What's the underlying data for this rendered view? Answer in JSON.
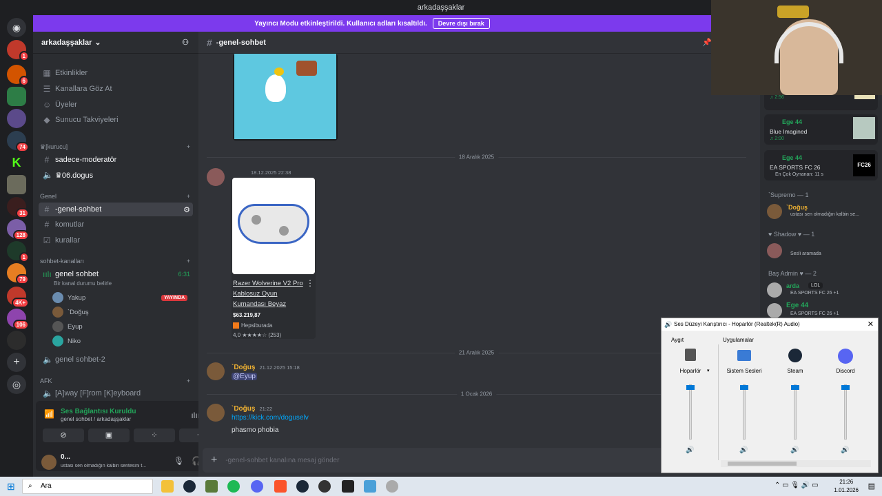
{
  "window": {
    "title": "arkadaşşaklar"
  },
  "banner": {
    "text": "Yayıncı Modu etkinleştirildi. Kullanıcı adları kısaltıldı.",
    "button": "Devre dışı bırak"
  },
  "rail": {
    "badges": [
      "1",
      "6",
      "74",
      "31",
      "128",
      "1",
      "79",
      "4K+",
      "106"
    ]
  },
  "server": {
    "name": "arkadaşşaklar",
    "top_items": [
      "Etkinlikler",
      "Kanallara Göz At",
      "Üyeler",
      "Sunucu Takviyeleri"
    ],
    "categories": {
      "kurucu": "♛[kurucu]",
      "genel": "Genel",
      "sohbet": "sohbet-kanalları",
      "afk": "AFK"
    },
    "channels": {
      "mod": "sadece-moderatör",
      "dogus": "♛06.dogus",
      "genel_sohbet": "-genel-sohbet",
      "komutlar": "komutlar",
      "kurallar": "kurallar",
      "voice_genel": "genel sohbet",
      "voice_status": "Bir kanal durumu belirle",
      "voice_timer": "6:31",
      "voice_genel2": "genel sohbet-2",
      "afk": "[A]way [F]rom [K]eyboard"
    },
    "voice_users": [
      {
        "name": "Yakup",
        "badge": "YAYINDA"
      },
      {
        "name": "`Doğuş"
      },
      {
        "name": "Eyup"
      },
      {
        "name": "Niko"
      }
    ]
  },
  "voice_panel": {
    "status": "Ses Bağlantısı Kuruldu",
    "sub": "genel sohbet / arkadaşşaklar"
  },
  "me": {
    "name": "0...",
    "status": "ustası sen olmadığın kalbin sentesini t..."
  },
  "chat": {
    "channel": "-genel-sohbet",
    "dividers": [
      "18 Aralık 2025",
      "21 Aralık 2025",
      "1 Ocak 2026"
    ],
    "msg1": {
      "time": "18.12.2025 22:38"
    },
    "product": {
      "title": "Razer Wolverine V2 Pro Kablosuz Oyun Kumandası Beyaz",
      "price": "$63.219,87",
      "store": "Hepsiburada",
      "rating": "4,0 ★★★★☆ (253)"
    },
    "msg2": {
      "name": "`Doğuş",
      "time": "21.12.2025 15:18",
      "text": "@Eyup"
    },
    "msg3": {
      "name": "`Doğuş",
      "time": "21:22",
      "link": "https://kick.com/doguselv",
      "text": "phasmo phobia"
    },
    "input_placeholder": "-genel-sohbet kanalına mesaj gönder"
  },
  "members": {
    "activities": [
      {
        "time": "♫ 2:56"
      },
      {
        "name": "Ege 44",
        "title": "Blue Imagined",
        "time": "♫ 2:00"
      },
      {
        "name": "Ege 44",
        "title": "EA SPORTS FC 26",
        "sub": "En Çok Oynanan: 11 s"
      }
    ],
    "groups": [
      {
        "label": "`Supremo — 1",
        "members": [
          {
            "name": "`Doğuş",
            "status": "ustası sen olmadığın kalbin se..."
          }
        ]
      },
      {
        "label": "♥ Shadow ♥ — 1",
        "members": [
          {
            "name": "",
            "status": "Sesli aramada"
          }
        ]
      },
      {
        "label": "Baş Admin ♥ — 2",
        "members": [
          {
            "name": "arda",
            "tag": "LOL",
            "status": "EA SPORTS FC 26 +1"
          },
          {
            "name": "Ege 44",
            "status": "EA SPORTS FC 26 +1"
          }
        ]
      }
    ]
  },
  "mixer": {
    "title": "Ses Düzeyi Karıştırıcı - Hoparlör (Realtek(R) Audio)",
    "device_label": "Aygıt",
    "apps_label": "Uygulamalar",
    "columns": [
      {
        "name": "Hoparlör",
        "level": 1.0
      },
      {
        "name": "Sistem Sesleri",
        "level": 1.0
      },
      {
        "name": "Steam",
        "level": 1.0
      },
      {
        "name": "Discord",
        "level": 1.0
      }
    ]
  },
  "taskbar": {
    "search": "Ara",
    "time": "21:26",
    "date": "1.01.2026"
  },
  "colors": {
    "accent": "#5865f2",
    "brand_purple": "#7c3aed",
    "online": "#23a55a"
  }
}
